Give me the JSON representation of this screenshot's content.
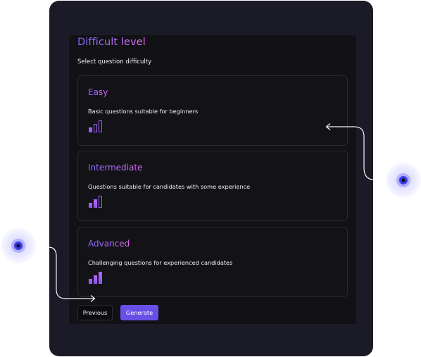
{
  "header": {
    "title": "Difficult level",
    "subtitle": "Select question difficulty"
  },
  "levels": [
    {
      "label": "Easy",
      "description": "Basic questions suitable for beginners",
      "filled_bars": 1,
      "total_bars": 3
    },
    {
      "label": "Intermediate",
      "description": "Questions suitable for candidates with some experience",
      "filled_bars": 2,
      "total_bars": 3
    },
    {
      "label": "Advanced",
      "description": "Challenging questions for experienced candidates",
      "filled_bars": 3,
      "total_bars": 3
    }
  ],
  "footer": {
    "previous_label": "Previous",
    "generate_label": "Generate"
  },
  "colors": {
    "frame": "#1b1b27",
    "panel": "#111116",
    "accent": "#6a4fe6",
    "gradient_start": "#7f67ff",
    "gradient_end": "#e56af1",
    "glow_dot": "#3a3ae6"
  },
  "icons": {
    "difficulty_bars": "signal-bars-icon",
    "hotspot": "pulse-dot-icon",
    "connector_arrow": "arrow-left-icon"
  }
}
